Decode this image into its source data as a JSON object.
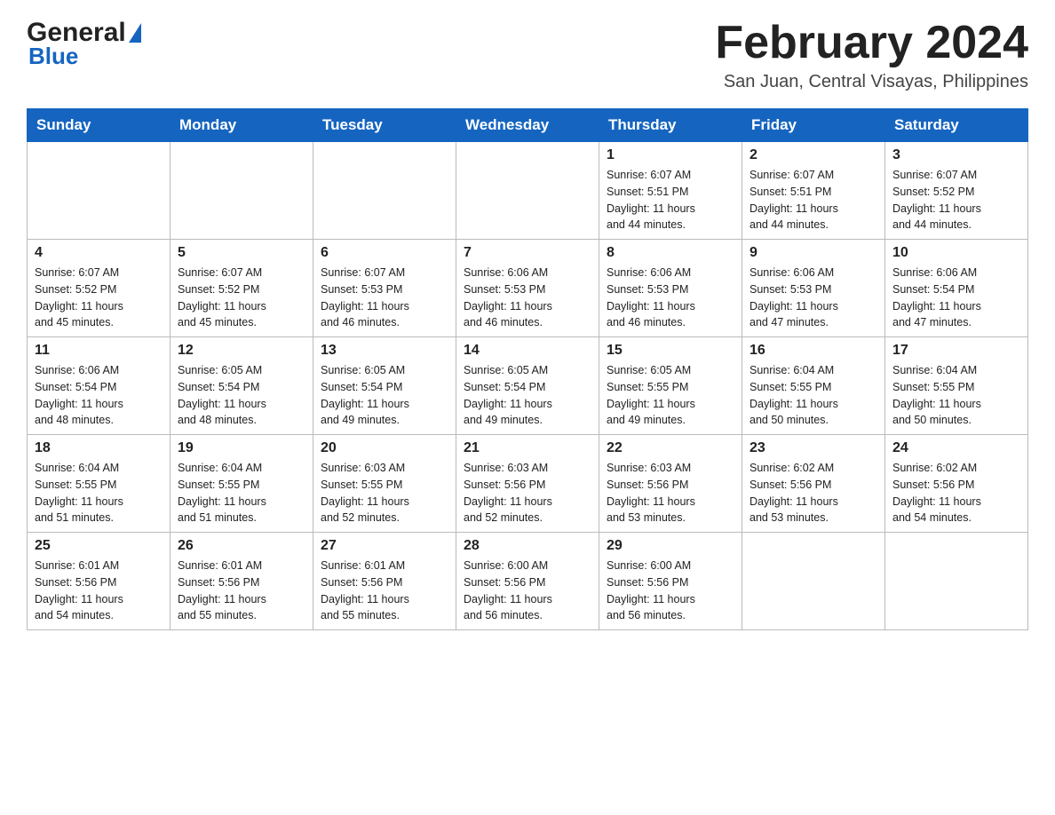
{
  "header": {
    "logo_general": "General",
    "logo_blue": "Blue",
    "month_year": "February 2024",
    "location": "San Juan, Central Visayas, Philippines"
  },
  "calendar": {
    "days_of_week": [
      "Sunday",
      "Monday",
      "Tuesday",
      "Wednesday",
      "Thursday",
      "Friday",
      "Saturday"
    ],
    "weeks": [
      {
        "days": [
          {
            "number": "",
            "info": ""
          },
          {
            "number": "",
            "info": ""
          },
          {
            "number": "",
            "info": ""
          },
          {
            "number": "",
            "info": ""
          },
          {
            "number": "1",
            "info": "Sunrise: 6:07 AM\nSunset: 5:51 PM\nDaylight: 11 hours\nand 44 minutes."
          },
          {
            "number": "2",
            "info": "Sunrise: 6:07 AM\nSunset: 5:51 PM\nDaylight: 11 hours\nand 44 minutes."
          },
          {
            "number": "3",
            "info": "Sunrise: 6:07 AM\nSunset: 5:52 PM\nDaylight: 11 hours\nand 44 minutes."
          }
        ]
      },
      {
        "days": [
          {
            "number": "4",
            "info": "Sunrise: 6:07 AM\nSunset: 5:52 PM\nDaylight: 11 hours\nand 45 minutes."
          },
          {
            "number": "5",
            "info": "Sunrise: 6:07 AM\nSunset: 5:52 PM\nDaylight: 11 hours\nand 45 minutes."
          },
          {
            "number": "6",
            "info": "Sunrise: 6:07 AM\nSunset: 5:53 PM\nDaylight: 11 hours\nand 46 minutes."
          },
          {
            "number": "7",
            "info": "Sunrise: 6:06 AM\nSunset: 5:53 PM\nDaylight: 11 hours\nand 46 minutes."
          },
          {
            "number": "8",
            "info": "Sunrise: 6:06 AM\nSunset: 5:53 PM\nDaylight: 11 hours\nand 46 minutes."
          },
          {
            "number": "9",
            "info": "Sunrise: 6:06 AM\nSunset: 5:53 PM\nDaylight: 11 hours\nand 47 minutes."
          },
          {
            "number": "10",
            "info": "Sunrise: 6:06 AM\nSunset: 5:54 PM\nDaylight: 11 hours\nand 47 minutes."
          }
        ]
      },
      {
        "days": [
          {
            "number": "11",
            "info": "Sunrise: 6:06 AM\nSunset: 5:54 PM\nDaylight: 11 hours\nand 48 minutes."
          },
          {
            "number": "12",
            "info": "Sunrise: 6:05 AM\nSunset: 5:54 PM\nDaylight: 11 hours\nand 48 minutes."
          },
          {
            "number": "13",
            "info": "Sunrise: 6:05 AM\nSunset: 5:54 PM\nDaylight: 11 hours\nand 49 minutes."
          },
          {
            "number": "14",
            "info": "Sunrise: 6:05 AM\nSunset: 5:54 PM\nDaylight: 11 hours\nand 49 minutes."
          },
          {
            "number": "15",
            "info": "Sunrise: 6:05 AM\nSunset: 5:55 PM\nDaylight: 11 hours\nand 49 minutes."
          },
          {
            "number": "16",
            "info": "Sunrise: 6:04 AM\nSunset: 5:55 PM\nDaylight: 11 hours\nand 50 minutes."
          },
          {
            "number": "17",
            "info": "Sunrise: 6:04 AM\nSunset: 5:55 PM\nDaylight: 11 hours\nand 50 minutes."
          }
        ]
      },
      {
        "days": [
          {
            "number": "18",
            "info": "Sunrise: 6:04 AM\nSunset: 5:55 PM\nDaylight: 11 hours\nand 51 minutes."
          },
          {
            "number": "19",
            "info": "Sunrise: 6:04 AM\nSunset: 5:55 PM\nDaylight: 11 hours\nand 51 minutes."
          },
          {
            "number": "20",
            "info": "Sunrise: 6:03 AM\nSunset: 5:55 PM\nDaylight: 11 hours\nand 52 minutes."
          },
          {
            "number": "21",
            "info": "Sunrise: 6:03 AM\nSunset: 5:56 PM\nDaylight: 11 hours\nand 52 minutes."
          },
          {
            "number": "22",
            "info": "Sunrise: 6:03 AM\nSunset: 5:56 PM\nDaylight: 11 hours\nand 53 minutes."
          },
          {
            "number": "23",
            "info": "Sunrise: 6:02 AM\nSunset: 5:56 PM\nDaylight: 11 hours\nand 53 minutes."
          },
          {
            "number": "24",
            "info": "Sunrise: 6:02 AM\nSunset: 5:56 PM\nDaylight: 11 hours\nand 54 minutes."
          }
        ]
      },
      {
        "days": [
          {
            "number": "25",
            "info": "Sunrise: 6:01 AM\nSunset: 5:56 PM\nDaylight: 11 hours\nand 54 minutes."
          },
          {
            "number": "26",
            "info": "Sunrise: 6:01 AM\nSunset: 5:56 PM\nDaylight: 11 hours\nand 55 minutes."
          },
          {
            "number": "27",
            "info": "Sunrise: 6:01 AM\nSunset: 5:56 PM\nDaylight: 11 hours\nand 55 minutes."
          },
          {
            "number": "28",
            "info": "Sunrise: 6:00 AM\nSunset: 5:56 PM\nDaylight: 11 hours\nand 56 minutes."
          },
          {
            "number": "29",
            "info": "Sunrise: 6:00 AM\nSunset: 5:56 PM\nDaylight: 11 hours\nand 56 minutes."
          },
          {
            "number": "",
            "info": ""
          },
          {
            "number": "",
            "info": ""
          }
        ]
      }
    ]
  }
}
